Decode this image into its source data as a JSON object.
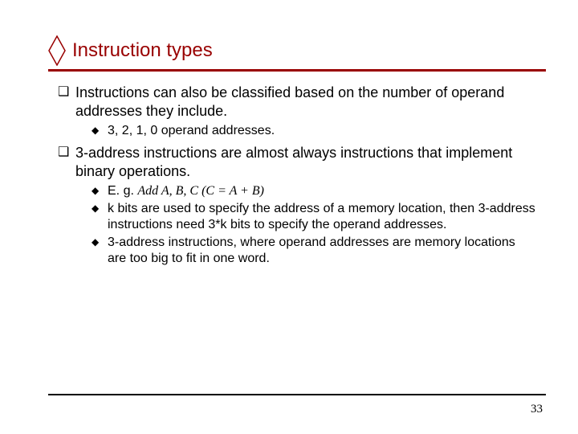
{
  "title": "Instruction types",
  "bullets": {
    "b1": {
      "text": "Instructions can also be classified based on the number of operand addresses they include.",
      "sub": {
        "s1": "3, 2, 1, 0 operand addresses."
      }
    },
    "b2": {
      "text": "3-address instructions are almost always instructions that implement binary operations.",
      "sub": {
        "s1_prefix": "E. g. ",
        "s1_italic": "Add A, B, C (C = A + B)",
        "s2": "k bits are used to specify the address of a memory location, then 3-address instructions need 3*k bits to specify the operand addresses.",
        "s3": "3-address instructions, where operand addresses are memory locations are too big to fit in one word."
      }
    }
  },
  "page_number": "33"
}
